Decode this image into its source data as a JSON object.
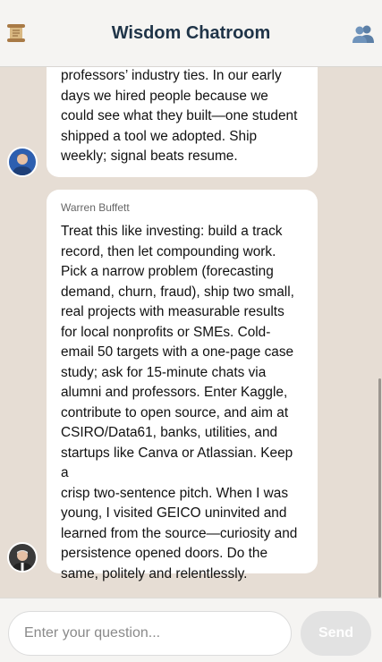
{
  "header": {
    "title": "Wisdom Chatroom",
    "left_icon": "scroll-icon",
    "right_icon": "users-icon"
  },
  "messages": [
    {
      "sender": "",
      "avatar": "mark-zuckerberg-avatar",
      "text": "professors’ industry ties. In our early\ndays we hired people because we\ncould see what they built—one student\nshipped a tool we adopted. Ship\nweekly; signal beats resume."
    },
    {
      "sender": "Warren Buffett",
      "avatar": "warren-buffett-avatar",
      "text": "Treat this like investing: build a track\nrecord, then let compounding work.\nPick a narrow problem (forecasting\ndemand, churn, fraud), ship two small,\nreal projects with measurable results\nfor local nonprofits or SMEs. Cold-\nemail 50 targets with a one-page case\nstudy; ask for 15-minute chats via\nalumni and professors. Enter Kaggle,\ncontribute to open source, and aim at\nCSIRO/Data61, banks, utilities, and\nstartups like Canva or Atlassian. Keep a\ncrisp two-sentence pitch. When I was\nyoung, I visited GEICO uninvited and\nlearned from the source—curiosity and\npersistence opened doors. Do the\nsame, politely and relentlessly."
    }
  ],
  "composer": {
    "placeholder": "Enter your question...",
    "value": "",
    "send_label": "Send"
  },
  "colors": {
    "header_bg": "#f5f4f2",
    "title": "#1f3448",
    "chat_bg": "#e6ddd4",
    "bubble_bg": "#ffffff",
    "send_disabled": "#e2e2e2"
  }
}
